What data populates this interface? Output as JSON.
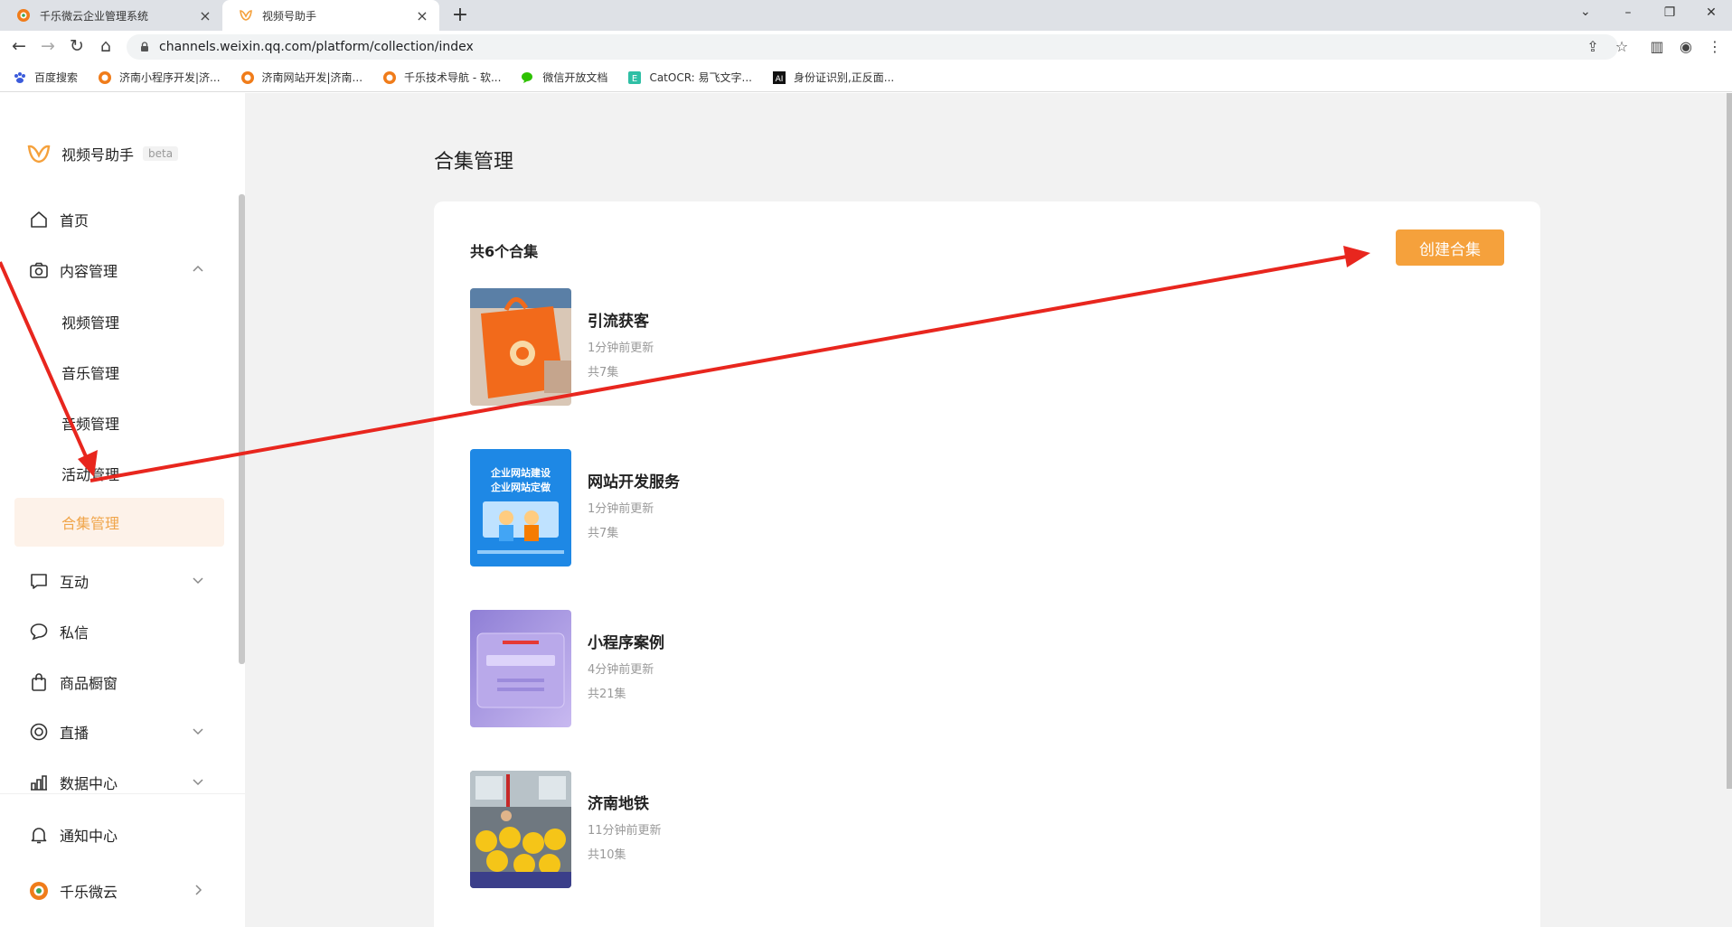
{
  "browser": {
    "tabs": [
      {
        "title": "千乐微云企业管理系统",
        "active": false
      },
      {
        "title": "视频号助手",
        "active": true
      }
    ],
    "url": "channels.weixin.qq.com/platform/collection/index",
    "bookmarks": [
      {
        "label": "百度搜索",
        "icon": "paw-icon"
      },
      {
        "label": "济南小程序开发|济...",
        "icon": "qianle-logo-icon"
      },
      {
        "label": "济南网站开发|济南...",
        "icon": "qianle-logo-icon"
      },
      {
        "label": "千乐技术导航 - 软...",
        "icon": "qianle-logo-icon"
      },
      {
        "label": "微信开放文档",
        "icon": "wechat-icon"
      },
      {
        "label": "CatOCR: 易飞文字...",
        "icon": "catocr-icon"
      },
      {
        "label": "身份证识别,正反面...",
        "icon": "ai-icon"
      }
    ]
  },
  "sidebar": {
    "brand": "视频号助手",
    "beta": "beta",
    "items": [
      {
        "label": "首页",
        "icon": "home-icon"
      },
      {
        "label": "内容管理",
        "icon": "camera-icon",
        "expanded": true
      },
      {
        "label": "互动",
        "icon": "chat-square-icon"
      },
      {
        "label": "私信",
        "icon": "message-bubble-icon"
      },
      {
        "label": "商品橱窗",
        "icon": "shopping-bag-icon"
      },
      {
        "label": "直播",
        "icon": "live-icon"
      },
      {
        "label": "数据中心",
        "icon": "bar-chart-icon"
      },
      {
        "label": "通知中心",
        "icon": "bell-icon"
      },
      {
        "label": "千乐微云",
        "icon": "account-avatar-icon"
      }
    ],
    "sub_items": [
      {
        "label": "视频管理"
      },
      {
        "label": "音乐管理"
      },
      {
        "label": "音频管理"
      },
      {
        "label": "活动管理"
      },
      {
        "label": "合集管理",
        "active": true
      }
    ]
  },
  "main": {
    "title": "合集管理",
    "count_label": "共6个合集",
    "create_button": "创建合集",
    "collections": [
      {
        "name": "引流获客",
        "updated": "1分钟前更新",
        "episodes": "共7集"
      },
      {
        "name": "网站开发服务",
        "updated": "1分钟前更新",
        "episodes": "共7集",
        "thumb_text": [
          "企业网站建设",
          "企业网站定做"
        ]
      },
      {
        "name": "小程序案例",
        "updated": "4分钟前更新",
        "episodes": "共21集"
      },
      {
        "name": "济南地铁",
        "updated": "11分钟前更新",
        "episodes": "共10集"
      }
    ]
  },
  "colors": {
    "accent": "#f5a13c",
    "active_bg": "#fdf2e9",
    "annotation_arrow": "#e8261e"
  }
}
